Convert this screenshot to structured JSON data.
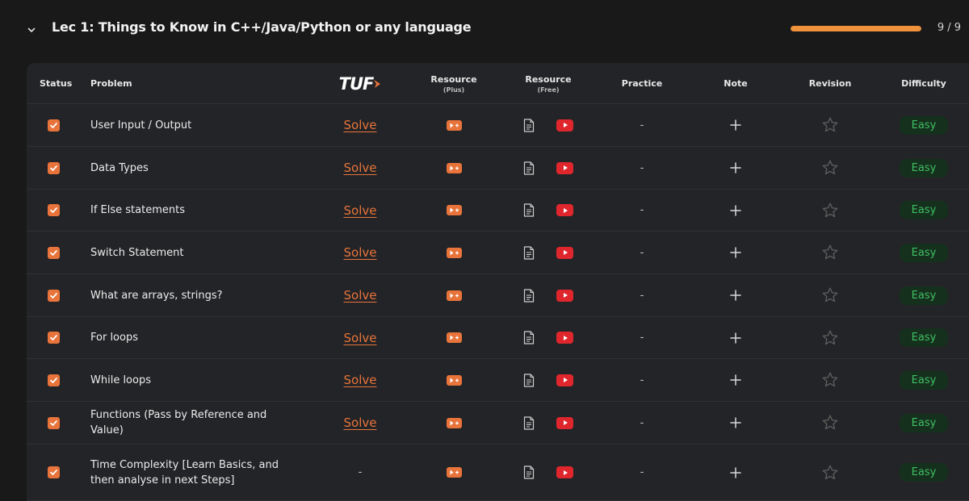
{
  "lecture": {
    "title": "Lec 1: Things to Know in C++/Java/Python or any language",
    "progress_text": "9 / 9",
    "progress_fraction": 1.0,
    "accent_color": "#f0913c"
  },
  "table": {
    "headers": {
      "status": "Status",
      "problem": "Problem",
      "tuf_logo": "TUF",
      "resource_plus": "Resource",
      "resource_plus_sub": "(Plus)",
      "resource_free": "Resource",
      "resource_free_sub": "(Free)",
      "practice": "Practice",
      "note": "Note",
      "revision": "Revision",
      "difficulty": "Difficulty"
    },
    "rows": [
      {
        "problem": "User Input / Output",
        "tuf": "Solve",
        "practice": "-",
        "difficulty": "Easy",
        "checked": true
      },
      {
        "problem": "Data Types",
        "tuf": "Solve",
        "practice": "-",
        "difficulty": "Easy",
        "checked": true
      },
      {
        "problem": "If Else statements",
        "tuf": "Solve",
        "practice": "-",
        "difficulty": "Easy",
        "checked": true
      },
      {
        "problem": "Switch Statement",
        "tuf": "Solve",
        "practice": "-",
        "difficulty": "Easy",
        "checked": true
      },
      {
        "problem": "What are arrays, strings?",
        "tuf": "Solve",
        "practice": "-",
        "difficulty": "Easy",
        "checked": true
      },
      {
        "problem": "For loops",
        "tuf": "Solve",
        "practice": "-",
        "difficulty": "Easy",
        "checked": true
      },
      {
        "problem": "While loops",
        "tuf": "Solve",
        "practice": "-",
        "difficulty": "Easy",
        "checked": true
      },
      {
        "problem": "Functions (Pass by Reference and Value)",
        "tuf": "Solve",
        "practice": "-",
        "difficulty": "Easy",
        "checked": true
      },
      {
        "problem": "Time Complexity [Learn Basics, and then analyse in next Steps]",
        "tuf": "-",
        "practice": "-",
        "difficulty": "Easy",
        "checked": true
      }
    ],
    "icons": {
      "status": "checkbox-checked-icon",
      "resource_plus": "video-plus-icon",
      "resource_free_article": "document-icon",
      "resource_free_video": "youtube-icon",
      "note": "plus-icon",
      "revision": "star-outline-icon",
      "collapse": "chevron-down-icon"
    }
  }
}
